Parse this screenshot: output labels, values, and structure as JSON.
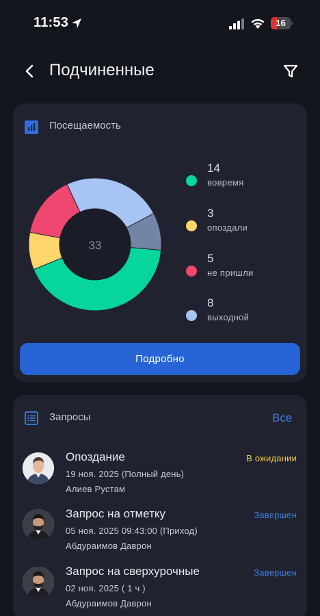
{
  "status_bar": {
    "time": "11:53",
    "battery": "16"
  },
  "header": {
    "title": "Подчиненные"
  },
  "attendance": {
    "title": "Посещаемость",
    "total": "33",
    "details_label": "Подробно",
    "segments": [
      {
        "count": "14",
        "label": "вовремя",
        "color": "#06d69c"
      },
      {
        "count": "3",
        "label": "опоздали",
        "color": "#ffd66b"
      },
      {
        "count": "5",
        "label": "не пришли",
        "color": "#ef476f"
      },
      {
        "count": "8",
        "label": "выходной",
        "color": "#a8c4f5"
      },
      {
        "count": "",
        "label": "",
        "color": "#7484a4"
      }
    ]
  },
  "chart_data": {
    "type": "pie",
    "categories": [
      "вовремя",
      "опоздали",
      "не пришли",
      "выходной",
      ""
    ],
    "values": [
      14,
      3,
      5,
      8,
      3
    ],
    "center_label": "33"
  },
  "requests": {
    "title": "Запросы",
    "all_label": "Все",
    "items": [
      {
        "type": "Опоздание",
        "date": "19 ноя. 2025 (Полный день)",
        "person": "Алиев Рустам",
        "status": "В ожидании",
        "status_color": "#f2c94c"
      },
      {
        "type": "Запрос на отметку",
        "date": "05 ноя. 2025 09:43:00 (Приход)",
        "person": "Абдураимов Даврон",
        "status": "Завершен",
        "status_color": "#3f7de8"
      },
      {
        "type": "Запрос на сверхурочные",
        "date": "02 ноя. 2025 ( 1 ч )",
        "person": "Абдураимов Даврон",
        "status": "Завершен",
        "status_color": "#3f7de8"
      }
    ]
  }
}
